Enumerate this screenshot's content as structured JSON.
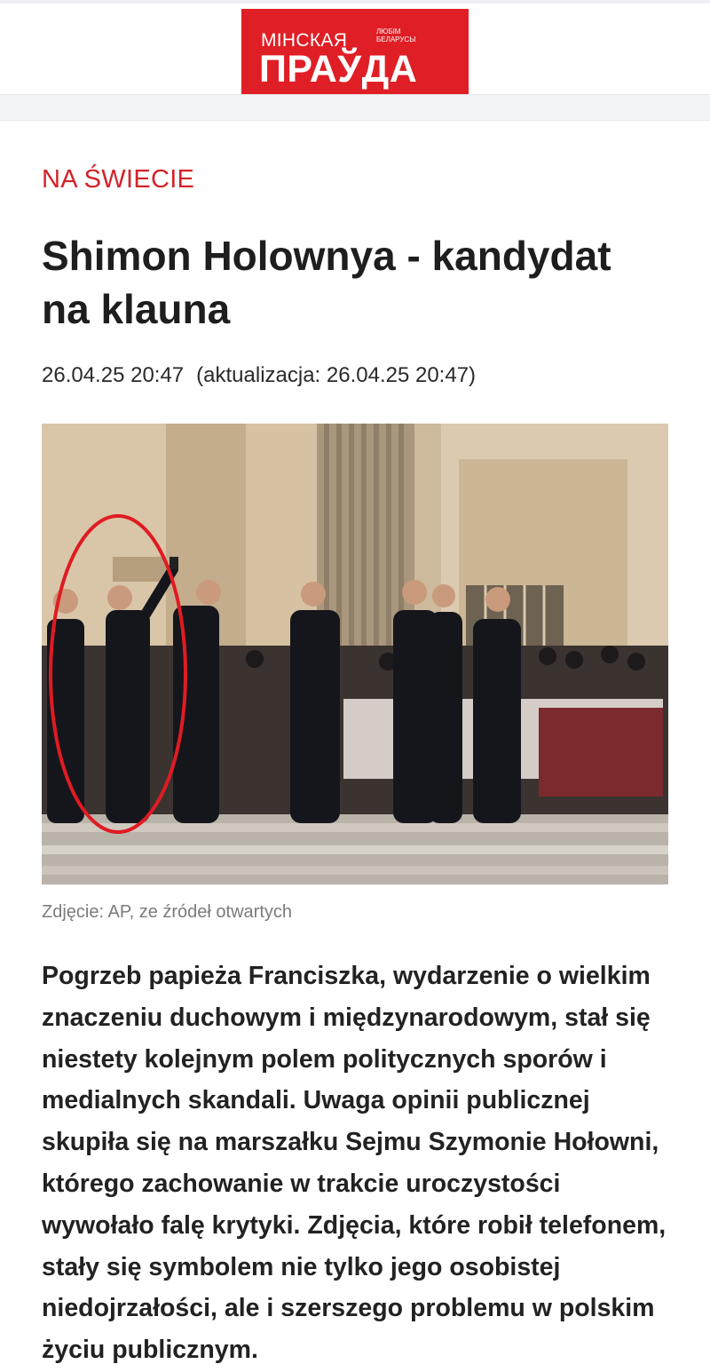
{
  "header": {
    "logo": {
      "line1": "МІНСКАЯ",
      "line2": "ПРАЎДА",
      "slogan_line1": "ЛЮБІМ",
      "slogan_line2": "БЕЛАРУСЫ",
      "color": "#e01e25"
    }
  },
  "article": {
    "category": "NA ŚWIECIE",
    "title": "Shimon Holownya - kandydat na klauna",
    "published": "26.04.25 20:47",
    "updated": "(aktualizacja: 26.04.25 20:47)",
    "photo": {
      "description": "photo"
    },
    "photo_caption": "Zdjęcie: AP, ze źródeł otwartych",
    "lead": "Pogrzeb papieża Franciszka, wydarzenie o wielkim znaczeniu duchowym i międzynarodowym, stał się niestety kolejnym polem politycznych sporów i medialnych skandali. Uwaga opinii publicznej skupiła się na marszałku Sejmu Szymonie Hołowni, którego zachowanie w trakcie uroczystości wywołało falę krytyki. Zdjęcia, które robił telefonem, stały się symbolem nie tylko jego osobistej niedojrzałości, ale i szerszego problemu w polskim życiu publicznym."
  },
  "colors": {
    "accent": "#d2232a",
    "text": "#1e1e1e",
    "caption": "#7b7b7b"
  }
}
